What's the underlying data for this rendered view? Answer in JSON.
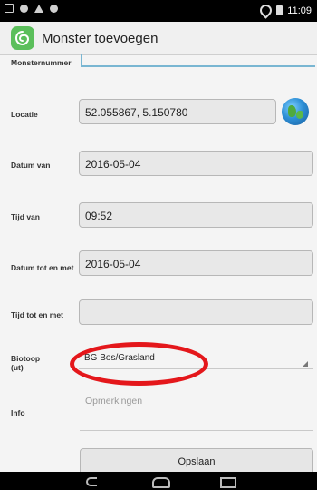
{
  "statusbar": {
    "time": "11:09"
  },
  "actionbar": {
    "title": "Monster toevoegen"
  },
  "form": {
    "monsternummer_label": "Monsternummer",
    "locatie_label": "Locatie",
    "locatie_value": "52.055867, 5.150780",
    "datum_van_label": "Datum van",
    "datum_van_value": "2016-05-04",
    "tijd_van_label": "Tijd van",
    "tijd_van_value": "09:52",
    "datum_tot_label": "Datum tot en met",
    "datum_tot_value": "2016-05-04",
    "tijd_tot_label": "Tijd tot en met",
    "tijd_tot_value": "",
    "biotoop_label_1": "Biotoop",
    "biotoop_label_2": "(ut)",
    "biotoop_value": "BG Bos/Grasland",
    "info_label": "Info",
    "info_placeholder": "Opmerkingen",
    "save_label": "Opslaan"
  },
  "colors": {
    "annotation": "#e4171b",
    "accent": "#79b6d2",
    "app_icon": "#5bbf5b"
  }
}
